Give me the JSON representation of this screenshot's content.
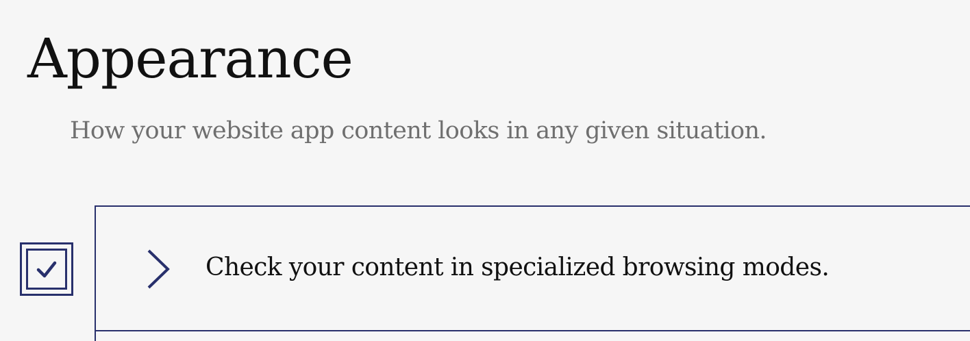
{
  "header": {
    "title": "Appearance",
    "subtitle": "How your website app content looks in any given situation."
  },
  "checklist": {
    "items": [
      {
        "label": "Check your content in specialized browsing modes.",
        "checked": true,
        "expanded": false,
        "icons": {
          "checkbox": "checkbox-checked-icon",
          "toggle": "chevron-right-icon"
        }
      }
    ]
  },
  "colors": {
    "accent": "#28306c",
    "background": "#f6f6f6",
    "title": "#111111",
    "subtitle": "#6f6f6f"
  }
}
